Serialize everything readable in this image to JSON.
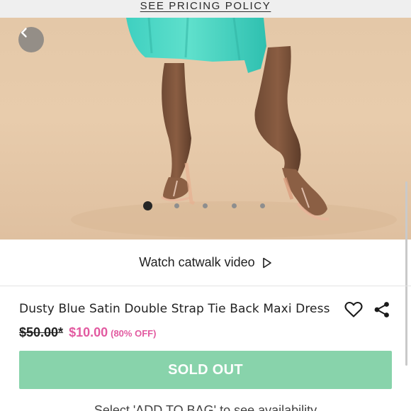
{
  "banner": {
    "link_text": "SEE PRICING POLICY"
  },
  "gallery": {
    "slide_count": 5,
    "active_slide": 1
  },
  "catwalk": {
    "label": "Watch catwalk video"
  },
  "product": {
    "title": "Dusty Blue Satin Double Strap Tie Back Maxi Dress",
    "old_price": "$50.00*",
    "new_price": "$10.00",
    "discount": "(80% OFF)"
  },
  "cta": {
    "label": "SOLD OUT"
  },
  "hint": {
    "text": "Select 'ADD TO BAG' to see availability"
  },
  "colors": {
    "accent_pink": "#e25aa0",
    "soldout_green": "#88d3ab",
    "banner_bg": "#efefef"
  },
  "icons": {
    "back": "chevron-left-icon",
    "wishlist": "heart-icon",
    "share": "share-icon",
    "play": "play-icon"
  }
}
